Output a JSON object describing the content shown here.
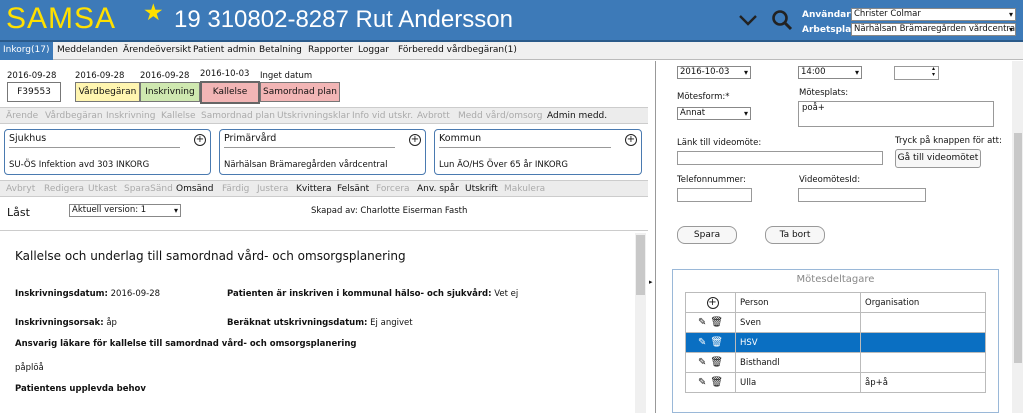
{
  "header": {
    "app_name": "SAMSA",
    "patient": "19 310802-8287 Rut Andersson",
    "user_label": "Användare:",
    "user_value": "Christer Colmar",
    "workplace_label": "Arbetsplats:",
    "workplace_value": "Närhälsan Brämaregården vårdcentra"
  },
  "menu": [
    "Inkorg(17)",
    "Meddelanden",
    "Ärendeöversikt",
    "Patient admin",
    "Betalning",
    "Rapporter",
    "Loggar",
    "Förberedd vårdbegäran(1)"
  ],
  "dates": [
    "2016-09-28",
    "2016-09-28",
    "2016-09-28",
    "2016-10-03",
    "Inget datum"
  ],
  "id_box": "F39553",
  "stages": [
    "Vårdbegäran",
    "Inskrivning",
    "Kallelse",
    "Samordnad plan"
  ],
  "toolbar1": [
    "Ärende",
    "Vårdbegäran",
    "Inskrivning",
    "Kallelse",
    "Samordnad plan",
    "Utskrivningsklar",
    "Info vid utskr.",
    "Avbrott",
    "Medd vård/omsorg",
    "Admin medd."
  ],
  "cards": [
    {
      "title": "Sjukhus",
      "value": "SU-ÖS Infektion avd 303 INKORG"
    },
    {
      "title": "Primärvård",
      "value": "Närhälsan Brämaregården vårdcentral"
    },
    {
      "title": "Kommun",
      "value": "Lun ÄO/HS Över 65 år INKORG"
    }
  ],
  "toolbar2": [
    "Avbryt",
    "Redigera",
    "Utkast",
    "SparaSänd",
    "Omsänd",
    "Färdig",
    "Justera",
    "Kvittera",
    "Felsänt",
    "Forcera",
    "Anv. spår",
    "Utskrift",
    "Makulera"
  ],
  "doc": {
    "locked": "Låst",
    "version": "Aktuell version: 1",
    "created_by": "Skapad av: Charlotte Eiserman Fasth",
    "title": "Kallelse och underlag till samordnad vård- och omsorgsplanering",
    "f1_label": "Inskrivningsdatum:",
    "f1_value": "2016-09-28",
    "f2_label": "Patienten är inskriven i kommunal hälso- och sjukvård:",
    "f2_value": "Vet ej",
    "f3_label": "Inskrivningsorsak:",
    "f3_value": "åp",
    "f4_label": "Beräknat utskrivningsdatum:",
    "f4_value": "Ej angivet",
    "f5_label": "Ansvarig läkare för kallelse till samordnad vård- och omsorgsplanering",
    "f5_value": "påplöå",
    "f6_label": "Patientens upplevda behov"
  },
  "meeting": {
    "date": "2016-10-03",
    "time": "14:00",
    "form_label": "Mötesform:*",
    "form_value": "Annat",
    "place_label": "Mötesplats:",
    "place_value": "poå+",
    "link_label": "Länk till videomöte:",
    "go_label": "Tryck på knappen för att:",
    "go_button": "Gå till videomötet",
    "phone_label": "Telefonnummer:",
    "video_id_label": "VideomötesId:",
    "save": "Spara",
    "delete": "Ta bort"
  },
  "participants": {
    "title": "Mötesdeltagare",
    "col_person": "Person",
    "col_org": "Organisation",
    "rows": [
      {
        "person": "Sven",
        "org": ""
      },
      {
        "person": "HSV",
        "org": ""
      },
      {
        "person": "Bisthandl",
        "org": ""
      },
      {
        "person": "Ulla",
        "org": "åp+å"
      }
    ]
  },
  "colors": {
    "header": "#3d7ab8",
    "logo": "#ffe000",
    "selected_row": "#0a6fc2",
    "stage_yellow": "#fff5b0",
    "stage_green": "#cfe8b0",
    "stage_red": "#f2b5b5"
  }
}
